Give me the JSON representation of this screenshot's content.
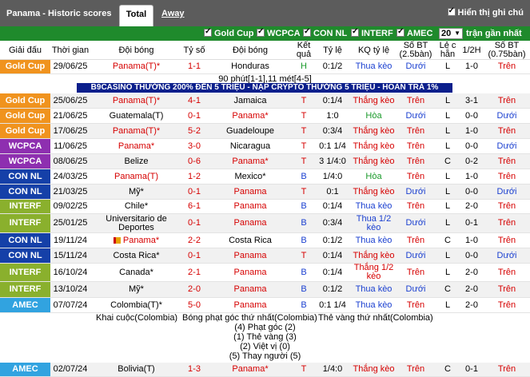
{
  "header": {
    "title": "Panama - Historic scores",
    "tab_total": "Total",
    "tab_away": "Away",
    "show_notes": "Hiển thị ghi chú"
  },
  "filters": {
    "items": [
      "Gold Cup",
      "WCPCA",
      "CON NL",
      "INTERF",
      "AMEC"
    ],
    "count_value": "20",
    "recent_label": "trận gần nhất"
  },
  "columns": {
    "league": "Giải đấu",
    "time": "Thời gian",
    "home": "Đội bóng",
    "score": "Tỷ số",
    "away": "Đội bóng",
    "result": "Kết quả",
    "ratio": "Tỷ lệ",
    "kq_ratio": "KQ tỷ lệ",
    "goals25": "Số BT (2.5bàn)",
    "odd_even": "Lẻ c hẵn",
    "half": "1/2H",
    "goals075": "Số BT (0.75bàn)"
  },
  "colors": {
    "gold_cup": "#f0931e",
    "wcpca": "#8e2fb0",
    "con_nl": "#1540a8",
    "interf": "#8ab02d",
    "amec": "#31a3e0",
    "result_win": "#d60000",
    "result_draw": "#1a9a2a",
    "result_loss": "#1a3fd0"
  },
  "matches": [
    {
      "league": "Gold Cup",
      "color": "#f0931e",
      "date": "29/06/25",
      "home": "Panama(T)*",
      "score": "1-1",
      "away": "Honduras",
      "res": "H",
      "ratio": "0:1/2",
      "kq": "Thua kèo",
      "g25": "Dưới",
      "oe": "L",
      "half": "1-0",
      "g075": "Trên"
    },
    {
      "league": "Gold Cup",
      "color": "#f0931e",
      "date": "25/06/25",
      "home": "Panama(T)*",
      "score": "4-1",
      "away": "Jamaica",
      "res": "T",
      "ratio": "0:1/4",
      "kq": "Thắng kèo",
      "g25": "Trên",
      "oe": "L",
      "half": "3-1",
      "g075": "Trên"
    },
    {
      "league": "Gold Cup",
      "color": "#f0931e",
      "date": "21/06/25",
      "home": "Guatemala(T)",
      "score": "0-1",
      "away": "Panama*",
      "res": "T",
      "ratio": "1:0",
      "kq": "Hòa",
      "g25": "Dưới",
      "oe": "L",
      "half": "0-0",
      "g075": "Dưới"
    },
    {
      "league": "Gold Cup",
      "color": "#f0931e",
      "date": "17/06/25",
      "home": "Panama(T)*",
      "score": "5-2",
      "away": "Guadeloupe",
      "res": "T",
      "ratio": "0:3/4",
      "kq": "Thắng kèo",
      "g25": "Trên",
      "oe": "L",
      "half": "1-0",
      "g075": "Trên"
    },
    {
      "league": "WCPCA",
      "color": "#8e2fb0",
      "date": "11/06/25",
      "home": "Panama*",
      "score": "3-0",
      "away": "Nicaragua",
      "res": "T",
      "ratio": "0:1 1/4",
      "kq": "Thắng kèo",
      "g25": "Trên",
      "oe": "L",
      "half": "0-0",
      "g075": "Dưới"
    },
    {
      "league": "WCPCA",
      "color": "#8e2fb0",
      "date": "08/06/25",
      "home": "Belize",
      "score": "0-6",
      "away": "Panama*",
      "res": "T",
      "ratio": "3 1/4:0",
      "kq": "Thắng kèo",
      "g25": "Trên",
      "oe": "C",
      "half": "0-2",
      "g075": "Trên"
    },
    {
      "league": "CON NL",
      "color": "#1540a8",
      "date": "24/03/25",
      "home": "Panama(T)",
      "score": "1-2",
      "away": "Mexico*",
      "res": "B",
      "ratio": "1/4:0",
      "kq": "Hòa",
      "g25": "Trên",
      "oe": "L",
      "half": "1-0",
      "g075": "Trên"
    },
    {
      "league": "CON NL",
      "color": "#1540a8",
      "date": "21/03/25",
      "home": "Mỹ*",
      "score": "0-1",
      "away": "Panama",
      "res": "T",
      "ratio": "0:1",
      "kq": "Thắng kèo",
      "g25": "Dưới",
      "oe": "L",
      "half": "0-0",
      "g075": "Dưới"
    },
    {
      "league": "INTERF",
      "color": "#8ab02d",
      "date": "09/02/25",
      "home": "Chile*",
      "score": "6-1",
      "away": "Panama",
      "res": "B",
      "ratio": "0:1/4",
      "kq": "Thua kèo",
      "g25": "Trên",
      "oe": "L",
      "half": "2-0",
      "g075": "Trên"
    },
    {
      "league": "INTERF",
      "color": "#8ab02d",
      "date": "25/01/25",
      "home": "Universitario de Deportes",
      "score": "0-1",
      "away": "Panama",
      "res": "B",
      "ratio": "0:3/4",
      "kq": "Thua 1/2 kèo",
      "g25": "Dưới",
      "oe": "L",
      "half": "0-1",
      "g075": "Trên"
    },
    {
      "league": "CON NL",
      "color": "#1540a8",
      "date": "19/11/24",
      "home": "Panama*",
      "home_flag": true,
      "score": "2-2",
      "away": "Costa Rica",
      "res": "B",
      "ratio": "0:1/2",
      "kq": "Thua kèo",
      "g25": "Trên",
      "oe": "C",
      "half": "1-0",
      "g075": "Trên"
    },
    {
      "league": "CON NL",
      "color": "#1540a8",
      "date": "15/11/24",
      "home": "Costa Rica*",
      "score": "0-1",
      "away": "Panama",
      "res": "T",
      "ratio": "0:1/4",
      "kq": "Thắng kèo",
      "g25": "Dưới",
      "oe": "L",
      "half": "0-0",
      "g075": "Dưới"
    },
    {
      "league": "INTERF",
      "color": "#8ab02d",
      "date": "16/10/24",
      "home": "Canada*",
      "score": "2-1",
      "away": "Panama",
      "res": "B",
      "ratio": "0:1/4",
      "kq": "Thắng 1/2 kèo",
      "g25": "Trên",
      "oe": "L",
      "half": "2-0",
      "g075": "Trên"
    },
    {
      "league": "INTERF",
      "color": "#8ab02d",
      "date": "13/10/24",
      "home": "Mỹ*",
      "score": "2-0",
      "away": "Panama",
      "res": "B",
      "ratio": "0:1/2",
      "kq": "Thua kèo",
      "g25": "Dưới",
      "oe": "C",
      "half": "2-0",
      "g075": "Trên"
    },
    {
      "league": "AMEC",
      "color": "#31a3e0",
      "date": "07/07/24",
      "home": "Colombia(T)*",
      "score": "5-0",
      "away": "Panama",
      "res": "B",
      "ratio": "0:1 1/4",
      "kq": "Thua kèo",
      "g25": "Trên",
      "oe": "L",
      "half": "2-0",
      "g075": "Trên"
    },
    {
      "league": "AMEC",
      "color": "#31a3e0",
      "date": "02/07/24",
      "home": "Bolivia(T)",
      "score": "1-3",
      "away": "Panama*",
      "res": "T",
      "ratio": "1/4:0",
      "kq": "Thắng kèo",
      "g25": "Trên",
      "oe": "C",
      "half": "0-1",
      "g075": "Trên"
    }
  ],
  "extra_time_note": "90 phút[1-1],11 mét[4-5]",
  "promo_banner": "B9CASINO THƯỞNG 200% ĐẾN 5 TRIỆU - NẠP CRYPTO THƯỞNG 5 TRIỆU - HOÀN TRẢ 1%",
  "detail": {
    "kickoff": "Khai cuộc(Colombia)",
    "first_corner": "Bóng phạt góc thứ nhất(Colombia)",
    "first_yellow": "Thẻ vàng thứ nhất(Colombia)",
    "lines": [
      "(4) Phạt góc (2)",
      "(1) Thẻ vàng (3)",
      "(2) Việt vị (0)",
      "(5) Thay người (5)"
    ]
  }
}
